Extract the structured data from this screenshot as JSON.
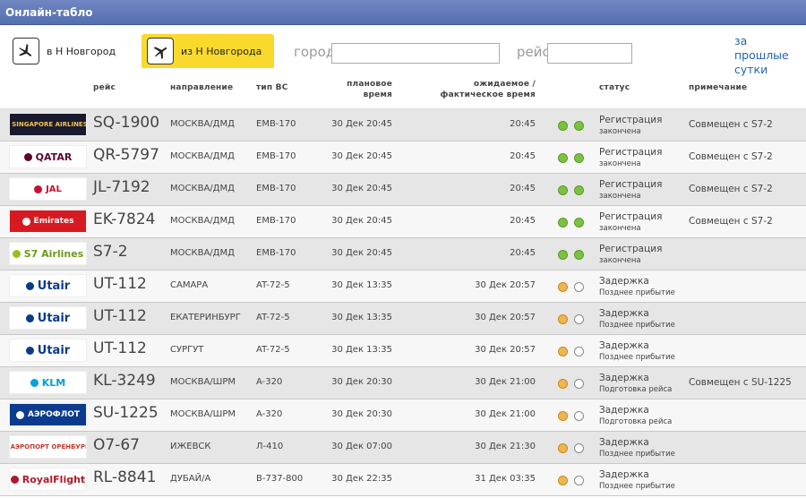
{
  "title": "Онлайн-табло",
  "toolbar": {
    "arrivals_label": "в Н Новгород",
    "departures_label": "из Н Новгорода",
    "city_label": "город",
    "city_value": "",
    "flight_label": "рейс",
    "flight_value": "",
    "past_link": "за прошлые сутки"
  },
  "columns": {
    "flight": "рейс",
    "direction": "направление",
    "aircraft": "тип ВС",
    "planned": "плановое время",
    "expected": "ожидаемое / фактическое время",
    "status": "статус",
    "note": "примечание"
  },
  "rows": [
    {
      "logo": "SINGAPORE AIRLINES",
      "flight": "SQ-1900",
      "direction": "МОСКВА/ДМД",
      "aircraft": "EMB-170",
      "planned": "30 Дек 20:45",
      "expected": "20:45",
      "dots": [
        "green",
        "green"
      ],
      "status": "Регистрация",
      "status_sub": "закончена",
      "note": "Совмещен с S7-2"
    },
    {
      "logo": "QATAR",
      "flight": "QR-5797",
      "direction": "МОСКВА/ДМД",
      "aircraft": "EMB-170",
      "planned": "30 Дек 20:45",
      "expected": "20:45",
      "dots": [
        "green",
        "green"
      ],
      "status": "Регистрация",
      "status_sub": "закончена",
      "note": "Совмещен с S7-2"
    },
    {
      "logo": "JAL",
      "flight": "JL-7192",
      "direction": "МОСКВА/ДМД",
      "aircraft": "EMB-170",
      "planned": "30 Дек 20:45",
      "expected": "20:45",
      "dots": [
        "green",
        "green"
      ],
      "status": "Регистрация",
      "status_sub": "закончена",
      "note": "Совмещен с S7-2"
    },
    {
      "logo": "Emirates",
      "flight": "EK-7824",
      "direction": "МОСКВА/ДМД",
      "aircraft": "EMB-170",
      "planned": "30 Дек 20:45",
      "expected": "20:45",
      "dots": [
        "green",
        "green"
      ],
      "status": "Регистрация",
      "status_sub": "закончена",
      "note": "Совмещен с S7-2"
    },
    {
      "logo": "S7 Airlines",
      "flight": "S7-2",
      "direction": "МОСКВА/ДМД",
      "aircraft": "EMB-170",
      "planned": "30 Дек 20:45",
      "expected": "20:45",
      "dots": [
        "green",
        "green"
      ],
      "status": "Регистрация",
      "status_sub": "закончена",
      "note": ""
    },
    {
      "logo": "Utair",
      "flight": "UT-112",
      "direction": "САМАРА",
      "aircraft": "AT-72-5",
      "planned": "30 Дек 13:35",
      "expected": "30 Дек 20:57",
      "dots": [
        "orange",
        "empty"
      ],
      "status": "Задержка",
      "status_sub": "Позднее прибытие",
      "note": ""
    },
    {
      "logo": "Utair",
      "flight": "UT-112",
      "direction": "ЕКАТЕРИНБУРГ",
      "aircraft": "AT-72-5",
      "planned": "30 Дек 13:35",
      "expected": "30 Дек 20:57",
      "dots": [
        "orange",
        "empty"
      ],
      "status": "Задержка",
      "status_sub": "Позднее прибытие",
      "note": ""
    },
    {
      "logo": "Utair",
      "flight": "UT-112",
      "direction": "СУРГУТ",
      "aircraft": "AT-72-5",
      "planned": "30 Дек 13:35",
      "expected": "30 Дек 20:57",
      "dots": [
        "orange",
        "empty"
      ],
      "status": "Задержка",
      "status_sub": "Позднее прибытие",
      "note": ""
    },
    {
      "logo": "KLM",
      "flight": "KL-3249",
      "direction": "МОСКВА/ШРМ",
      "aircraft": "A-320",
      "planned": "30 Дек 20:30",
      "expected": "30 Дек 21:00",
      "dots": [
        "orange",
        "empty"
      ],
      "status": "Задержка",
      "status_sub": "Подготовка рейса",
      "note": "Совмещен с SU-1225"
    },
    {
      "logo": "АЭРОФЛОТ",
      "flight": "SU-1225",
      "direction": "МОСКВА/ШРМ",
      "aircraft": "A-320",
      "planned": "30 Дек 20:30",
      "expected": "30 Дек 21:00",
      "dots": [
        "orange",
        "empty"
      ],
      "status": "Задержка",
      "status_sub": "Подготовка рейса",
      "note": ""
    },
    {
      "logo": "АЭРОПОРТ ОРЕНБУРГ",
      "flight": "O7-67",
      "direction": "ИЖЕВСК",
      "aircraft": "Л-410",
      "planned": "30 Дек 07:00",
      "expected": "30 Дек 21:30",
      "dots": [
        "orange",
        "empty"
      ],
      "status": "Задержка",
      "status_sub": "Позднее прибытие",
      "note": ""
    },
    {
      "logo": "RoyalFlight",
      "flight": "RL-8841",
      "direction": "ДУБАЙ/А",
      "aircraft": "B-737-800",
      "planned": "30 Дек 22:35",
      "expected": "31 Дек 03:35",
      "dots": [
        "orange",
        "empty"
      ],
      "status": "Задержка",
      "status_sub": "Позднее прибытие",
      "note": ""
    }
  ]
}
